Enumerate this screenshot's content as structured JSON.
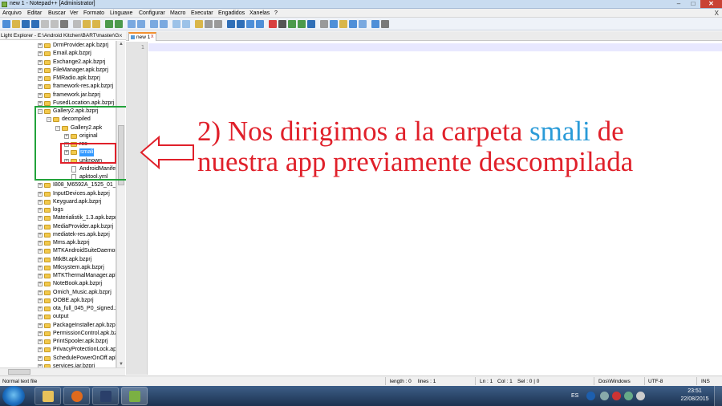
{
  "window": {
    "title": "new 1 - Notepad++ [Administrator]",
    "min": "–",
    "max": "□",
    "close": "✕"
  },
  "menu": {
    "items": [
      "Arquivo",
      "Editar",
      "Buscar",
      "Ver",
      "Formato",
      "Linguaxe",
      "Configurar",
      "Macro",
      "Executar",
      "Engadidos",
      "Xanelas",
      "?"
    ],
    "close": "X"
  },
  "toolbar": {
    "colors": {
      "file": "#4f8fd8",
      "save": "#2f6fb8",
      "edit": "#d9b64a",
      "search": "#7aa9e0",
      "macro": "#d84040",
      "view": "#4f8fd8"
    }
  },
  "explorer": {
    "title": "Light Explorer - E:\\Android Kitchen\\BART\\master\\G",
    "close": "×",
    "tree": [
      {
        "label": "DrmProvider.apk.bzprj",
        "depth": 0,
        "exp": "+",
        "kind": "folder"
      },
      {
        "label": "Email.apk.bzprj",
        "depth": 0,
        "exp": "+",
        "kind": "folder"
      },
      {
        "label": "Exchange2.apk.bzprj",
        "depth": 0,
        "exp": "+",
        "kind": "folder"
      },
      {
        "label": "FileManager.apk.bzprj",
        "depth": 0,
        "exp": "+",
        "kind": "folder"
      },
      {
        "label": "FMRadio.apk.bzprj",
        "depth": 0,
        "exp": "+",
        "kind": "folder"
      },
      {
        "label": "framework-res.apk.bzprj",
        "depth": 0,
        "exp": "+",
        "kind": "folder"
      },
      {
        "label": "framework.jar.bzprj",
        "depth": 0,
        "exp": "+",
        "kind": "folder"
      },
      {
        "label": "FusedLocation.apk.bzprj",
        "depth": 0,
        "exp": "+",
        "kind": "folder"
      },
      {
        "label": "Gallery2.apk.bzprj",
        "depth": 0,
        "exp": "−",
        "kind": "folder"
      },
      {
        "label": "decompiled",
        "depth": 1,
        "exp": "−",
        "kind": "folder"
      },
      {
        "label": "Gallery2.apk",
        "depth": 2,
        "exp": "−",
        "kind": "folder"
      },
      {
        "label": "original",
        "depth": 3,
        "exp": "+",
        "kind": "folder"
      },
      {
        "label": "res",
        "depth": 3,
        "exp": "+",
        "kind": "folder"
      },
      {
        "label": "smali",
        "depth": 3,
        "exp": "+",
        "kind": "folder",
        "selected": true
      },
      {
        "label": "unknown",
        "depth": 3,
        "exp": "+",
        "kind": "folder"
      },
      {
        "label": "AndroidManife",
        "depth": 3,
        "exp": "",
        "kind": "file"
      },
      {
        "label": "apktool.yml",
        "depth": 3,
        "exp": "",
        "kind": "file"
      },
      {
        "label": "I808_M6592A_1525_01_V3.",
        "depth": 0,
        "exp": "+",
        "kind": "folder"
      },
      {
        "label": "InputDevices.apk.bzprj",
        "depth": 0,
        "exp": "+",
        "kind": "folder"
      },
      {
        "label": "Keyguard.apk.bzprj",
        "depth": 0,
        "exp": "+",
        "kind": "folder"
      },
      {
        "label": "logs",
        "depth": 0,
        "exp": "+",
        "kind": "folder"
      },
      {
        "label": "Materialistik_1.3.apk.bzprj",
        "depth": 0,
        "exp": "+",
        "kind": "folder"
      },
      {
        "label": "MediaProvider.apk.bzprj",
        "depth": 0,
        "exp": "+",
        "kind": "folder"
      },
      {
        "label": "mediatek-res.apk.bzprj",
        "depth": 0,
        "exp": "+",
        "kind": "folder"
      },
      {
        "label": "Mms.apk.bzprj",
        "depth": 0,
        "exp": "+",
        "kind": "folder"
      },
      {
        "label": "MTKAndroidSuiteDaemor",
        "depth": 0,
        "exp": "+",
        "kind": "folder"
      },
      {
        "label": "MtkBt.apk.bzprj",
        "depth": 0,
        "exp": "+",
        "kind": "folder"
      },
      {
        "label": "Mtksystem.apk.bzprj",
        "depth": 0,
        "exp": "+",
        "kind": "folder"
      },
      {
        "label": "MTKThermalManager.apk",
        "depth": 0,
        "exp": "+",
        "kind": "folder"
      },
      {
        "label": "NoteBook.apk.bzprj",
        "depth": 0,
        "exp": "+",
        "kind": "folder"
      },
      {
        "label": "Omich_Music.apk.bzprj",
        "depth": 0,
        "exp": "+",
        "kind": "folder"
      },
      {
        "label": "OOBE.apk.bzprj",
        "depth": 0,
        "exp": "+",
        "kind": "folder"
      },
      {
        "label": "ota_full_045_P0_signed.zip",
        "depth": 0,
        "exp": "+",
        "kind": "folder"
      },
      {
        "label": "output",
        "depth": 0,
        "exp": "+",
        "kind": "folder"
      },
      {
        "label": "PackageInstaller.apk.bzprj",
        "depth": 0,
        "exp": "+",
        "kind": "folder"
      },
      {
        "label": "PermissionControl.apk.bz",
        "depth": 0,
        "exp": "+",
        "kind": "folder"
      },
      {
        "label": "PrintSpooler.apk.bzprj",
        "depth": 0,
        "exp": "+",
        "kind": "folder"
      },
      {
        "label": "PrivacyProtectionLock.apl",
        "depth": 0,
        "exp": "+",
        "kind": "folder"
      },
      {
        "label": "SchedulePowerOnOff.apk",
        "depth": 0,
        "exp": "+",
        "kind": "folder"
      },
      {
        "label": "services.jar.bzprj",
        "depth": 0,
        "exp": "+",
        "kind": "folder"
      }
    ]
  },
  "editor": {
    "tab_label": "new 1",
    "tab_close": "x",
    "line_number": "1"
  },
  "annotation": {
    "line1_before": "2) Nos dirigimos a la carpeta ",
    "line1_highlight": "smali",
    "line1_after": " de",
    "line2": "nuestra app previamente descompilada",
    "color": "#e0202a",
    "highlight_color": "#2a9bd8"
  },
  "status": {
    "left": "Normal text file",
    "length": "length : 0",
    "lines": "lines : 1",
    "ln": "Ln : 1",
    "col": "Col : 1",
    "sel": "Sel : 0 | 0",
    "eol": "Dos\\Windows",
    "encoding": "UTF-8",
    "mode": "INS"
  },
  "taskbar": {
    "lang": "ES",
    "time": "23:51",
    "date": "22/08/2015"
  }
}
